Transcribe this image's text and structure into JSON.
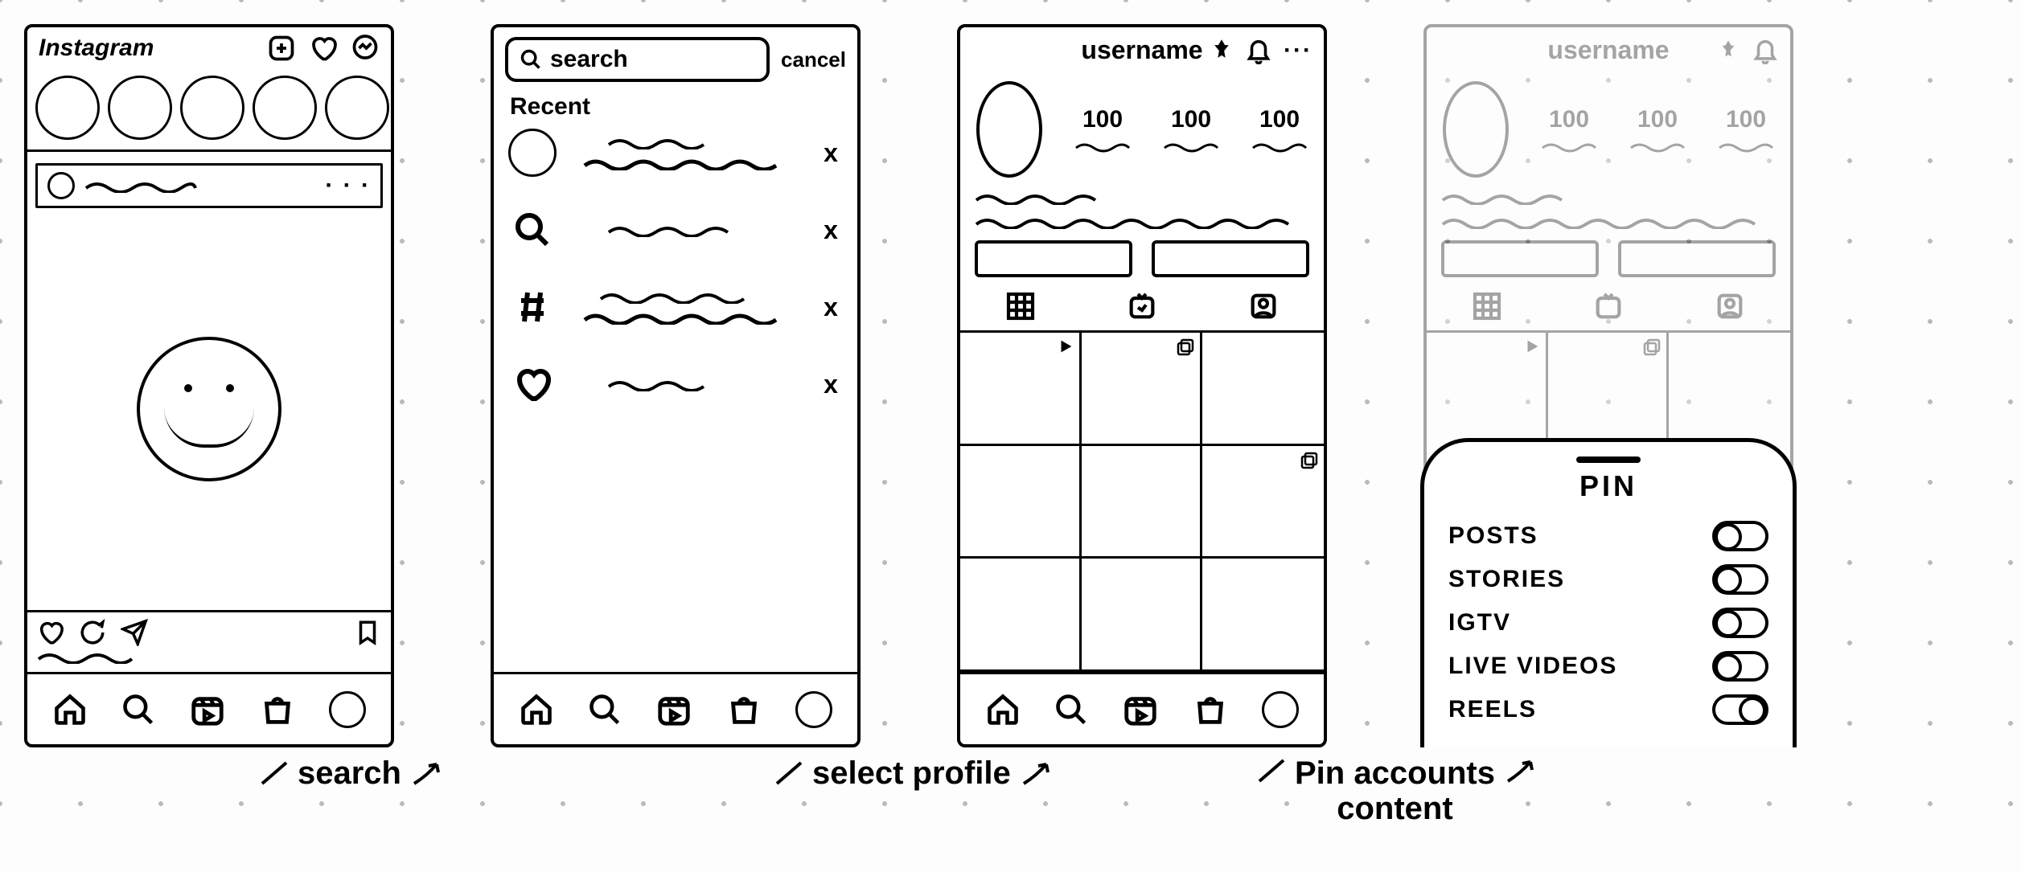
{
  "screen1": {
    "logo": "Instagram",
    "post_more": "· · ·"
  },
  "screen2": {
    "search_placeholder": "search",
    "cancel": "cancel",
    "recent_label": "Recent",
    "rows": [
      {
        "type": "account",
        "close": "x"
      },
      {
        "type": "search",
        "close": "x"
      },
      {
        "type": "hashtag",
        "close": "x"
      },
      {
        "type": "liked",
        "close": "x"
      }
    ]
  },
  "screen3": {
    "username": "username",
    "stats": {
      "posts": "100",
      "followers": "100",
      "following": "100"
    },
    "more": "···"
  },
  "screen4": {
    "username": "username",
    "stats": {
      "posts": "100",
      "followers": "100",
      "following": "100"
    },
    "sheet": {
      "title": "PIN",
      "options": [
        {
          "label": "Posts",
          "on": false
        },
        {
          "label": "Stories",
          "on": false
        },
        {
          "label": "IGTV",
          "on": false
        },
        {
          "label": "Live videos",
          "on": false
        },
        {
          "label": "Reels",
          "on": true
        }
      ]
    }
  },
  "annotations": {
    "a1": "search",
    "a2": "select profile",
    "a3_line1": "Pin accounts",
    "a3_line2": "content"
  }
}
